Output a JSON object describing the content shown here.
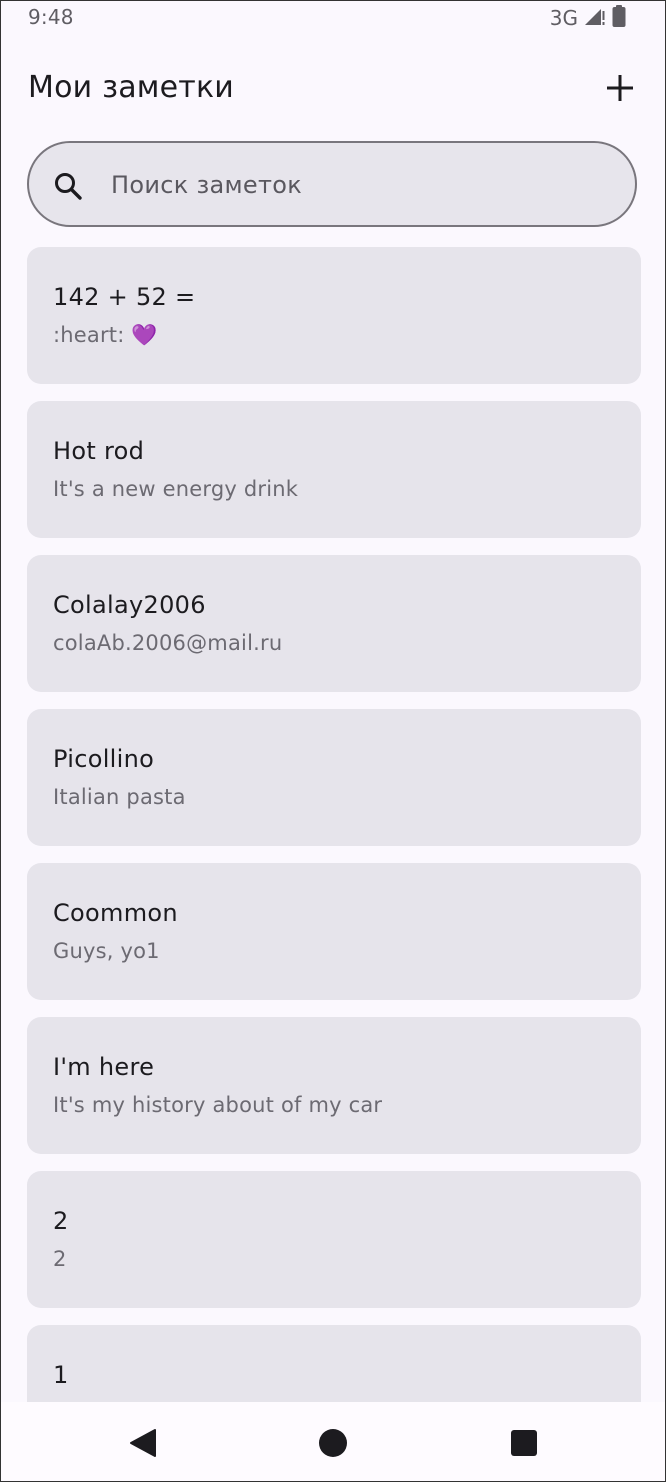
{
  "status_bar": {
    "time": "9:48",
    "network": "3G",
    "signal_icon": "signal-icon",
    "battery_icon": "battery-icon"
  },
  "header": {
    "title": "Мои заметки",
    "add_icon": "plus-icon"
  },
  "search": {
    "placeholder": "Поиск заметок",
    "value": "",
    "icon": "search-icon"
  },
  "notes": [
    {
      "title": "142 + 52 =",
      "body": ":heart: 💜"
    },
    {
      "title": "Hot rod",
      "body": "It's a new energy drink"
    },
    {
      "title": "Colalay2006",
      "body": "colaAb.2006@mail.ru"
    },
    {
      "title": "Picollino",
      "body": "Italian pasta"
    },
    {
      "title": "Coommon",
      "body": "Guys, yo1"
    },
    {
      "title": "I'm here",
      "body": "It's my history about of my car"
    },
    {
      "title": "2",
      "body": "2"
    },
    {
      "title": "1",
      "body": ""
    }
  ],
  "nav_bar": {
    "back_icon": "back-triangle-icon",
    "home_icon": "home-circle-icon",
    "recents_icon": "recents-square-icon"
  },
  "colors": {
    "background": "#fbf8fe",
    "card": "#e6e4eb",
    "title_text": "#1c1b1f",
    "secondary_text": "#6c6a72",
    "search_border": "#79767d"
  }
}
